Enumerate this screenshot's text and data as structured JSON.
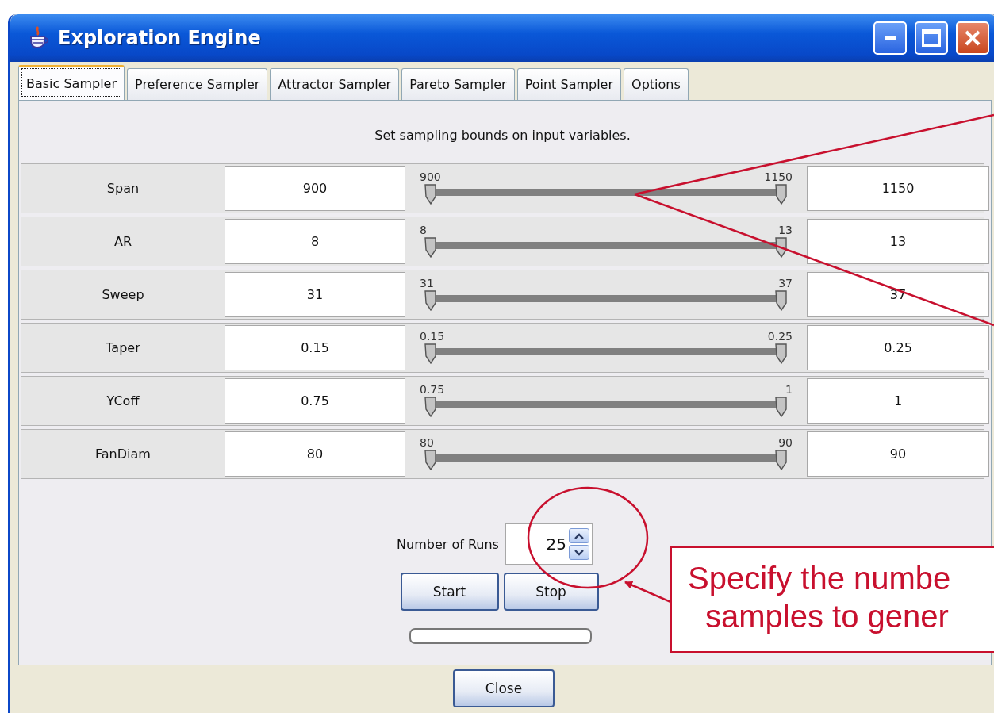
{
  "window": {
    "title": "Exploration Engine"
  },
  "tabs": [
    {
      "label": "Basic Sampler",
      "selected": true
    },
    {
      "label": "Preference Sampler",
      "selected": false
    },
    {
      "label": "Attractor Sampler",
      "selected": false
    },
    {
      "label": "Pareto Sampler",
      "selected": false
    },
    {
      "label": "Point Sampler",
      "selected": false
    },
    {
      "label": "Options",
      "selected": false
    }
  ],
  "caption": "Set sampling bounds on input variables.",
  "variables": [
    {
      "name": "Span",
      "min": "900",
      "min_label": "900",
      "max_label": "1150",
      "max": "1150",
      "thumbs": [
        {
          "level": 0
        },
        {
          "level": 1
        }
      ]
    },
    {
      "name": "AR",
      "min": "8",
      "min_label": "8",
      "max_label": "13",
      "max": "13",
      "thumbs": [
        {
          "level": 0
        },
        {
          "level": 1
        }
      ]
    },
    {
      "name": "Sweep",
      "min": "31",
      "min_label": "31",
      "max_label": "37",
      "max": "37",
      "thumbs": [
        {
          "level": 0
        },
        {
          "level": 1
        }
      ]
    },
    {
      "name": "Taper",
      "min": "0.15",
      "min_label": "0.15",
      "max_label": "0.25",
      "max": "0.25",
      "thumbs": [
        {
          "level": 0
        },
        {
          "level": 1
        }
      ]
    },
    {
      "name": "YCoff",
      "min": "0.75",
      "min_label": "0.75",
      "max_label": "1",
      "max": "1",
      "thumbs": [
        {
          "level": 0
        },
        {
          "level": 1
        }
      ]
    },
    {
      "name": "FanDiam",
      "min": "80",
      "min_label": "80",
      "max_label": "90",
      "max": "90",
      "thumbs": [
        {
          "level": 0
        },
        {
          "level": 1
        }
      ]
    }
  ],
  "runs": {
    "label": "Number of Runs",
    "value": "25"
  },
  "buttons": [
    {
      "label": "Start"
    },
    {
      "label": "Stop"
    }
  ],
  "progress": {
    "level": 0
  },
  "close_button": {
    "label": "Close"
  },
  "annotation": {
    "lines": [
      "Specify the numbe",
      "samples to gener"
    ]
  }
}
